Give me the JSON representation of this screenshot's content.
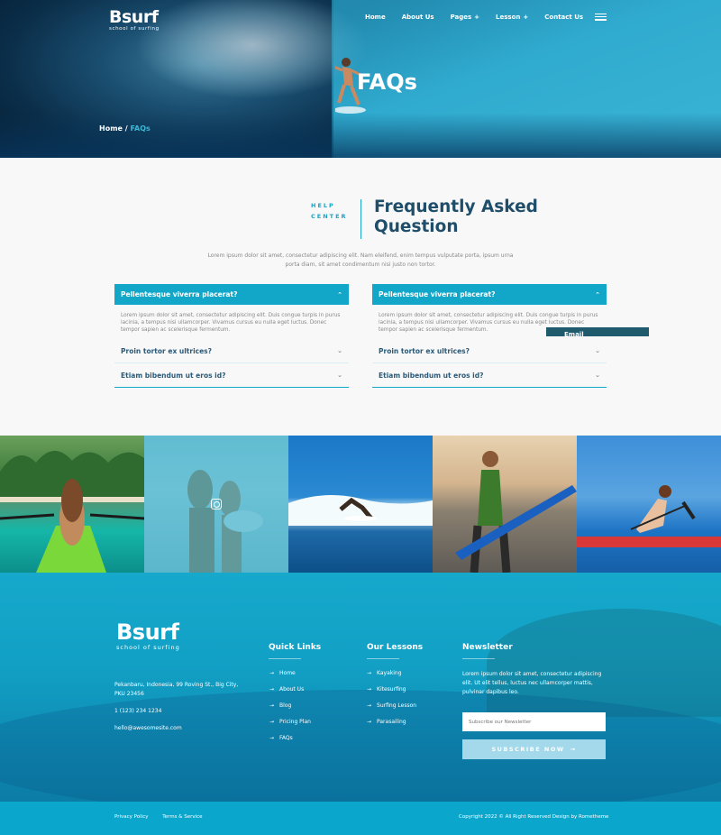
{
  "brand": {
    "name": "Bsurf",
    "tagline": "school of surfing"
  },
  "nav": {
    "items": [
      {
        "label": "Home"
      },
      {
        "label": "About Us"
      },
      {
        "label": "Pages",
        "has_dropdown": true
      },
      {
        "label": "Lesson",
        "has_dropdown": true
      },
      {
        "label": "Contact Us"
      }
    ],
    "menu_icon": "hamburger-icon"
  },
  "hero": {
    "title": "FAQs",
    "breadcrumb": {
      "home": "Home",
      "separator": " / ",
      "current": "FAQs"
    }
  },
  "faq": {
    "eyebrow_line1": "HELP",
    "eyebrow_line2": "CENTER",
    "title_line1": "Frequently Asked",
    "title_line2": "Question",
    "intro": "Lorem ipsum dolor sit amet, consectetur adipiscing elit. Nam eleifend, enim tempus vulputate porta, ipsum urna porta diam, sit amet condimentum nisi justo non tortor.",
    "left": {
      "open": {
        "question": "Pellentesque viverra placerat?",
        "answer": "Lorem ipsum dolor sit amet, consectetur adipiscing elit. Duis congue turpis in purus lacinia, a tempus nisi ullamcorper. Vivamus cursus eu nulla eget luctus. Donec tempor sapien ac scelerisque fermentum."
      },
      "q2": "Proin tortor ex ultrices?",
      "q3": "Etiam bibendum ut eros id?"
    },
    "right": {
      "open": {
        "question": "Pellentesque viverra placerat?",
        "answer": "Lorem ipsum dolor sit amet, consectetur adipiscing elit. Duis congue turpis in purus lacinia, a tempus nisi ullamcorper. Vivamus cursus eu nulla eget luctus. Donec tempor sapien ac scelerisque fermentum."
      },
      "q2": "Proin tortor ex ultrices?",
      "q3": "Etiam bibendum ut eros id?"
    },
    "floating_tab": "Email"
  },
  "footer": {
    "address": "Pekanbaru, Indonesia, 99 Roving St., Big City, PKU 23456",
    "phone": "1 (123) 234 1234",
    "email": "hello@awesomesite.com",
    "quick_links": {
      "heading": "Quick Links",
      "items": [
        "Home",
        "About Us",
        "Blog",
        "Pricing Plan",
        "FAQs"
      ]
    },
    "lessons": {
      "heading": "Our Lessons",
      "items": [
        "Kayaking",
        "Kitesurfing",
        "Surfing Lesson",
        "Parasailing"
      ]
    },
    "newsletter": {
      "heading": "Newsletter",
      "text": "Lorem ipsum dolor sit amet, consectetur adipiscing elit. Ut elit tellus, luctus nec ullamcorper mattis, pulvinar dapibus leo.",
      "placeholder": "Subscribe our Newsletter",
      "button": "SUBSCRIBE NOW"
    },
    "bottom": {
      "privacy": "Privacy Policy",
      "terms": "Terms & Service",
      "copyright": "Copyright 2022 © All Right Reserved Design by Rometheme"
    }
  },
  "colors": {
    "accent": "#12a7c9",
    "title": "#1f4e6b",
    "footer_bar": "#0aa6cc"
  }
}
